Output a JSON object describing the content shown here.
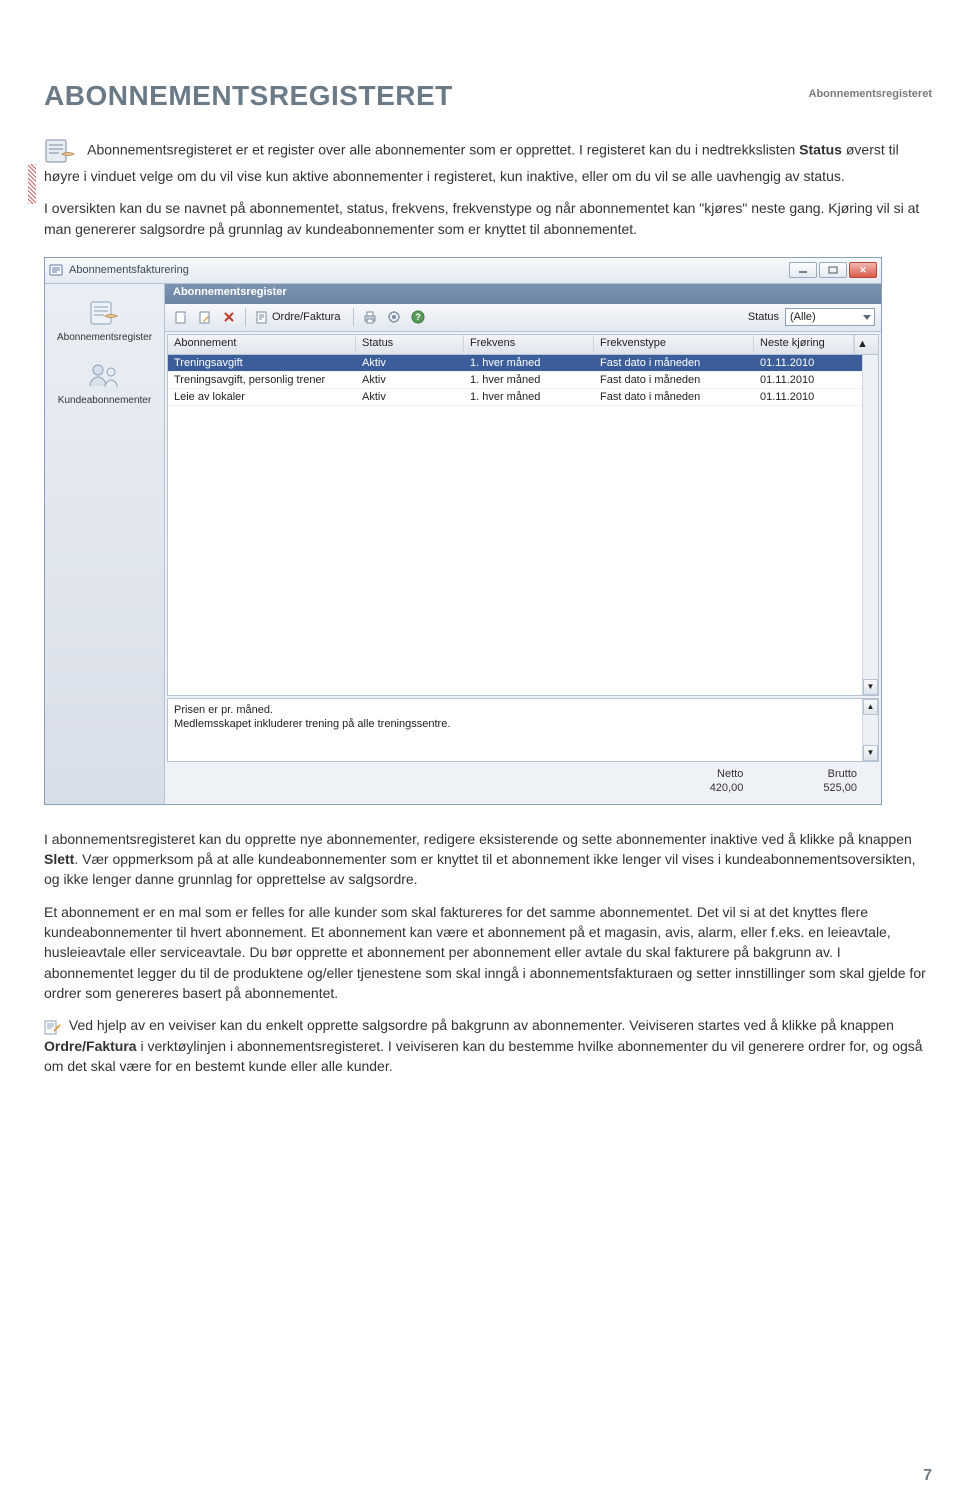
{
  "page": {
    "header_right": "Abonnementsregisteret",
    "title": "ABONNEMENTSREGISTERET",
    "page_number": "7"
  },
  "intro": {
    "p1a": "Abonnementsregisteret er et register over alle abonnementer som er opprettet. I registeret kan du i nedtrekkslisten ",
    "p1b": "Status",
    "p1c": " øverst til høyre i vinduet velge om du vil vise kun aktive abonnementer i registeret, kun inaktive, eller om du vil se alle uavhengig av status.",
    "p2": "I oversikten kan du se navnet på abonnementet, status, frekvens, frekvenstype og når abonnementet kan \"kjøres\" neste gang. Kjøring vil si at man genererer salgsordre på grunnlag av kundeabonnementer som er knyttet til abonnementet."
  },
  "app": {
    "window_title": "Abonnementsfakturering",
    "panel_title": "Abonnementsregister",
    "sidebar": {
      "items": [
        {
          "label": "Abonnementsregister"
        },
        {
          "label": "Kundeabonnementer"
        }
      ]
    },
    "toolbar": {
      "ordre_faktura": "Ordre/Faktura",
      "status_label": "Status",
      "status_value": "(Alle)"
    },
    "grid": {
      "columns": {
        "abonnement": "Abonnement",
        "status": "Status",
        "frekvens": "Frekvens",
        "frekvenstype": "Frekvenstype",
        "neste": "Neste kjøring"
      },
      "rows": [
        {
          "abonnement": "Treningsavgift",
          "status": "Aktiv",
          "frekvens": "1. hver måned",
          "frekvenstype": "Fast dato i måneden",
          "neste": "01.11.2010"
        },
        {
          "abonnement": "Treningsavgift, personlig trener",
          "status": "Aktiv",
          "frekvens": "1. hver måned",
          "frekvenstype": "Fast dato i måneden",
          "neste": "01.11.2010"
        },
        {
          "abonnement": "Leie av lokaler",
          "status": "Aktiv",
          "frekvens": "1. hver måned",
          "frekvenstype": "Fast dato i måneden",
          "neste": "01.11.2010"
        }
      ]
    },
    "description": {
      "line1": "Prisen er pr. måned.",
      "line2": "Medlemsskapet inkluderer trening på alle treningssentre."
    },
    "totals": {
      "netto_label": "Netto",
      "netto_value": "420,00",
      "brutto_label": "Brutto",
      "brutto_value": "525,00"
    }
  },
  "after": {
    "p1a": "I abonnementsregisteret kan du opprette nye abonnementer, redigere eksisterende og sette abonnementer inaktive ved å klikke på knappen ",
    "p1b": "Slett",
    "p1c": ". Vær oppmerksom på at alle kundeabonnementer som er knyttet til et abonnement ikke lenger vil vises i kundeabonnementsoversikten, og ikke lenger danne grunnlag for opprettelse av salgsordre.",
    "p2": "Et abonnement er en mal som er felles for alle kunder som skal faktureres for det samme abonnementet. Det vil si at det knyttes flere kundeabonnementer til hvert abonnement. Et abonnement kan være et abonnement på et magasin, avis, alarm, eller f.eks. en leieavtale, husleieavtale eller serviceavtale. Du bør opprette et abonnement per abonnement eller avtale du skal fakturere på bakgrunn av. I abonnementet legger du til de produktene og/eller tjenestene som skal inngå i abonnementsfakturaen og setter innstillinger som skal gjelde for ordrer som genereres basert på abonnementet.",
    "p3a": "Ved hjelp av en veiviser kan du enkelt opprette salgsordre på bakgrunn av abonnementer. Veiviseren startes ved å klikke på knappen ",
    "p3b": "Ordre/Faktura",
    "p3c": " i verktøylinjen i abonnementsregisteret. I veiviseren kan du bestemme hvilke abonnementer du vil generere ordrer for, og også om det skal være for en bestemt kunde eller alle kunder."
  }
}
